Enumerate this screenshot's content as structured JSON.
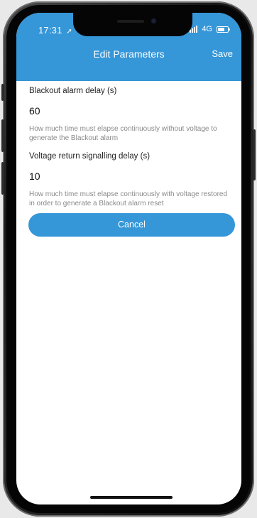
{
  "status_bar": {
    "time": "17:31",
    "network": "4G"
  },
  "nav": {
    "title": "Edit Parameters",
    "save_label": "Save"
  },
  "fields": [
    {
      "label": "Blackout alarm delay (s)",
      "value": "60",
      "help": "How much time must elapse continuously without voltage to generate the Blackout alarm"
    },
    {
      "label": "Voltage return signalling delay (s)",
      "value": "10",
      "help": "How much time must elapse continuously with voltage restored in order to generate a Blackout alarm reset"
    }
  ],
  "actions": {
    "cancel_label": "Cancel"
  },
  "colors": {
    "accent": "#3596d8"
  }
}
